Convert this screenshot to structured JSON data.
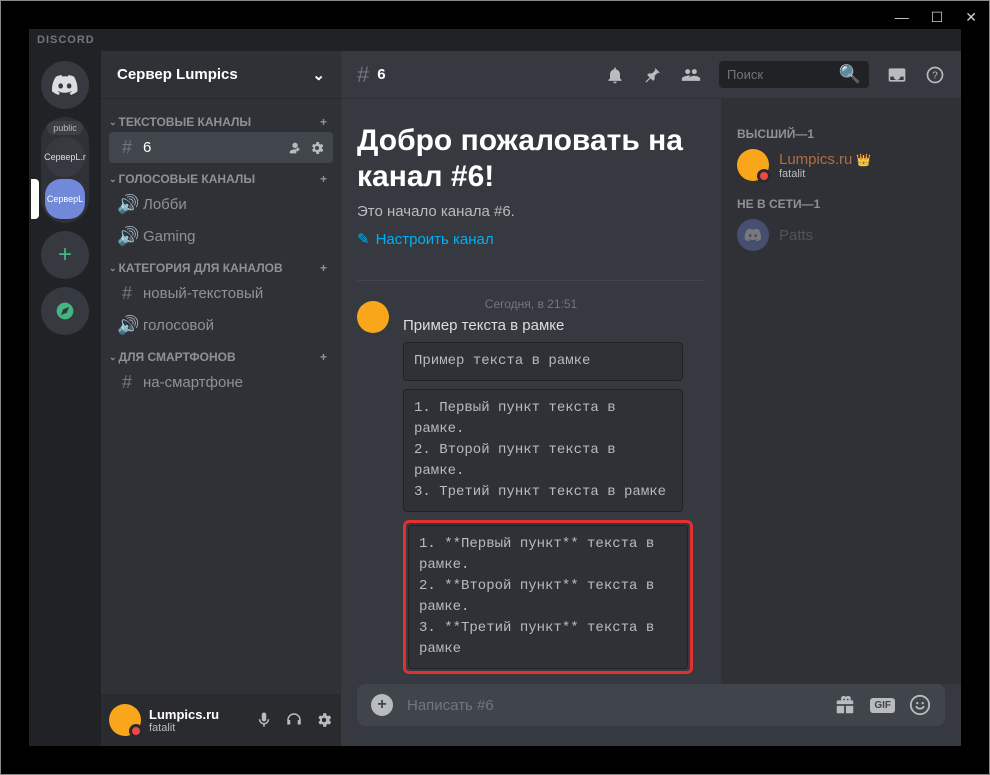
{
  "titlebar": "DISCORD",
  "server": {
    "name": "Сервер Lumpics"
  },
  "folder_label": "public",
  "guilds": {
    "g1": "СерверL.r",
    "g2": "СерверL"
  },
  "categories": {
    "text": {
      "label": "ТЕКСТОВЫЕ КАНАЛЫ",
      "items": [
        {
          "name": "6"
        }
      ]
    },
    "voice": {
      "label": "ГОЛОСОВЫЕ КАНАЛЫ",
      "items": [
        {
          "name": "Лобби"
        },
        {
          "name": "Gaming"
        }
      ]
    },
    "cat2": {
      "label": "КАТЕГОРИЯ ДЛЯ КАНАЛОВ",
      "items": [
        {
          "name": "новый-текстовый",
          "type": "text"
        },
        {
          "name": "голосовой",
          "type": "voice"
        }
      ]
    },
    "phones": {
      "label": "ДЛЯ СМАРТФОНОВ",
      "items": [
        {
          "name": "на-смартфоне",
          "type": "text"
        }
      ]
    }
  },
  "user_panel": {
    "name": "Lumpics.ru",
    "status": "fatalit"
  },
  "header": {
    "channel": "6",
    "search_placeholder": "Поиск"
  },
  "welcome": {
    "title_l1": "Добро пожаловать на",
    "title_l2": "канал #6!",
    "subtitle": "Это начало канала #6.",
    "setup": "Настроить канал"
  },
  "message": {
    "timestamp": "Сегодня, в 21:51",
    "line": "Пример текста в рамке",
    "block1": "Пример текста в рамке",
    "block2": "1. Первый пункт текста в рамке.\n2. Второй пункт текста в рамке.\n3. Третий пункт текста в рамке",
    "block3": "1. **Первый пункт** текста в рамке.\n2. **Второй пункт** текста в рамке.\n3. **Третий пункт** текста в рамке"
  },
  "input": {
    "placeholder": "Написать #6",
    "gif": "GIF"
  },
  "members": {
    "role1": "ВЫСШИЙ—1",
    "top": {
      "name": "Lumpics.ru",
      "status": "fatalit"
    },
    "role2": "НЕ В СЕТИ—1",
    "offline": {
      "name": "Patts"
    }
  }
}
